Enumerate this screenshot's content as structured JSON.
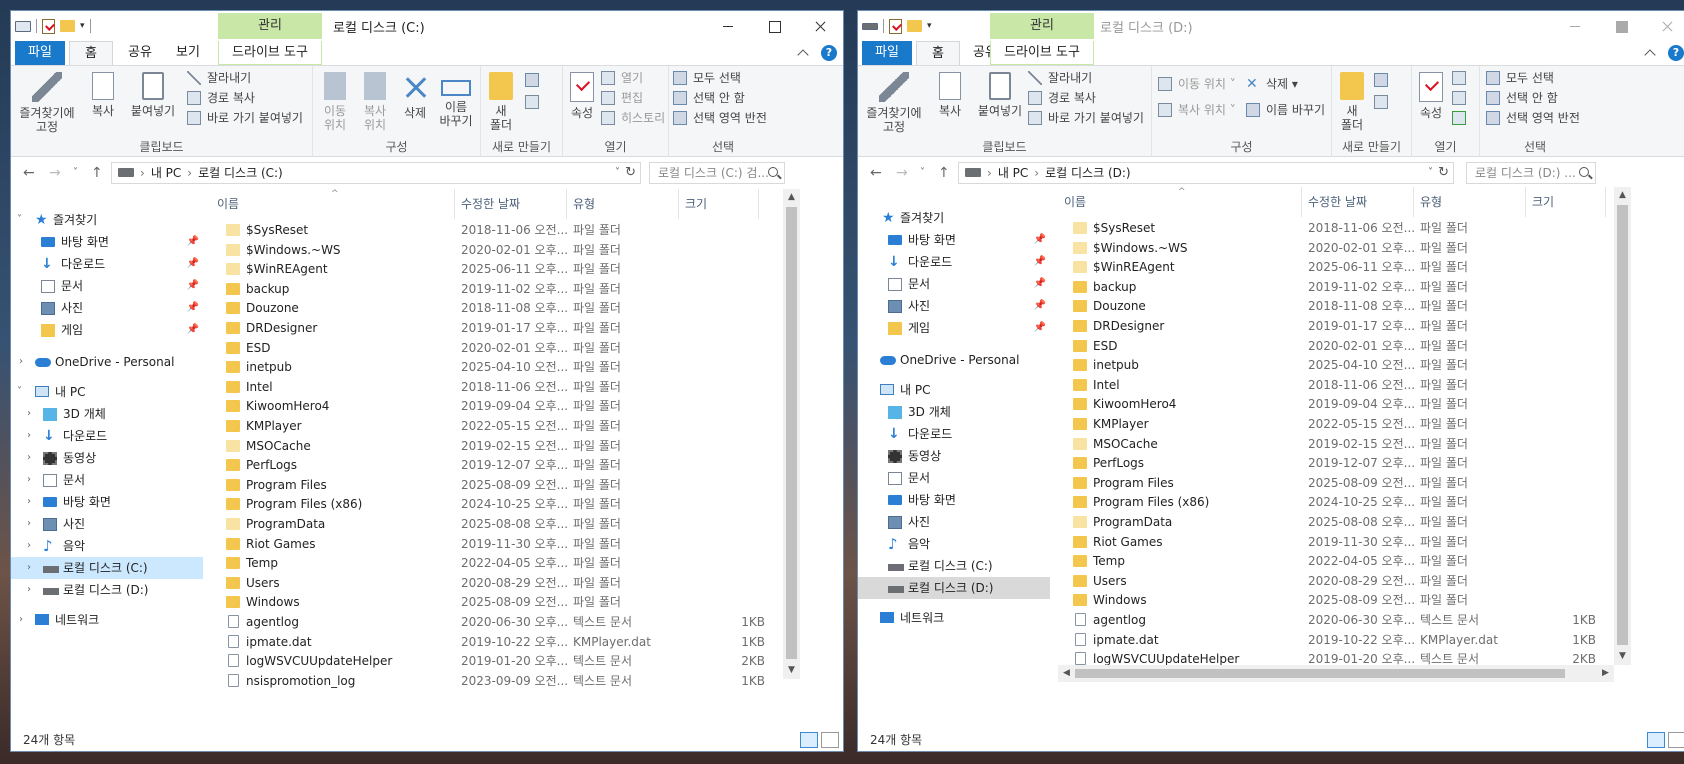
{
  "ribbon_labels": {
    "tabs": {
      "file": "파일",
      "home": "홈",
      "share": "공유",
      "view": "보기",
      "context_header": "관리",
      "drive_tools": "드라이브 도구"
    },
    "pin": "즐겨찾기에\n고정",
    "copy": "복사",
    "paste": "붙여넣기",
    "cut": "잘라내기",
    "copy_path": "경로 복사",
    "paste_shortcut": "바로 가기 붙여넣기",
    "clipboard_group": "클립보드",
    "move_to": "이동\n위치",
    "copy_to": "복사\n위치",
    "delete": "삭제",
    "rename": "이름\n바꾸기",
    "move_to_inline": "이동 위치",
    "copy_to_inline": "복사 위치",
    "delete_inline": "삭제",
    "rename_inline": "이름 바꾸기",
    "organize_group": "구성",
    "new_folder": "새\n폴더",
    "new_group": "새로 만들기",
    "properties": "속성",
    "open": "열기",
    "edit": "편집",
    "history": "히스토리",
    "open_group": "열기",
    "select_all": "모두 선택",
    "select_none": "선택 안 함",
    "invert": "선택 영역 반전",
    "select_group": "선택"
  },
  "nav_labels": {
    "favorites": "즐겨찾기",
    "desktop": "바탕 화면",
    "downloads": "다운로드",
    "documents": "문서",
    "pictures": "사진",
    "games": "게임",
    "onedrive": "OneDrive - Personal",
    "this_pc": "내 PC",
    "objects3d": "3D 개체",
    "videos": "동영상",
    "music": "음악",
    "drive_c": "로컬 디스크 (C:)",
    "drive_d": "로컬 디스크 (D:)",
    "network": "네트워크"
  },
  "columns": {
    "name": "이름",
    "modified": "수정한 날짜",
    "type": "유형",
    "size": "크기"
  },
  "files": [
    {
      "name": "$SysReset",
      "date": "2018-11-06 오전...",
      "type": "파일 폴더",
      "size": "",
      "icon": "sys"
    },
    {
      "name": "$Windows.~WS",
      "date": "2020-02-01 오후...",
      "type": "파일 폴더",
      "size": "",
      "icon": "sys"
    },
    {
      "name": "$WinREAgent",
      "date": "2025-06-11 오후...",
      "type": "파일 폴더",
      "size": "",
      "icon": "sys"
    },
    {
      "name": "backup",
      "date": "2019-11-02 오후...",
      "type": "파일 폴더",
      "size": "",
      "icon": "folder"
    },
    {
      "name": "Douzone",
      "date": "2018-11-08 오후...",
      "type": "파일 폴더",
      "size": "",
      "icon": "folder"
    },
    {
      "name": "DRDesigner",
      "date": "2019-01-17 오후...",
      "type": "파일 폴더",
      "size": "",
      "icon": "folder"
    },
    {
      "name": "ESD",
      "date": "2020-02-01 오후...",
      "type": "파일 폴더",
      "size": "",
      "icon": "folder"
    },
    {
      "name": "inetpub",
      "date": "2025-04-10 오전...",
      "type": "파일 폴더",
      "size": "",
      "icon": "folder"
    },
    {
      "name": "Intel",
      "date": "2018-11-06 오전...",
      "type": "파일 폴더",
      "size": "",
      "icon": "folder"
    },
    {
      "name": "KiwoomHero4",
      "date": "2019-09-04 오후...",
      "type": "파일 폴더",
      "size": "",
      "icon": "folder"
    },
    {
      "name": "KMPlayer",
      "date": "2022-05-15 오전...",
      "type": "파일 폴더",
      "size": "",
      "icon": "folder"
    },
    {
      "name": "MSOCache",
      "date": "2019-02-15 오전...",
      "type": "파일 폴더",
      "size": "",
      "icon": "sys"
    },
    {
      "name": "PerfLogs",
      "date": "2019-12-07 오후...",
      "type": "파일 폴더",
      "size": "",
      "icon": "folder"
    },
    {
      "name": "Program Files",
      "date": "2025-08-09 오전...",
      "type": "파일 폴더",
      "size": "",
      "icon": "folder"
    },
    {
      "name": "Program Files (x86)",
      "date": "2024-10-25 오후...",
      "type": "파일 폴더",
      "size": "",
      "icon": "folder"
    },
    {
      "name": "ProgramData",
      "date": "2025-08-08 오후...",
      "type": "파일 폴더",
      "size": "",
      "icon": "sys"
    },
    {
      "name": "Riot Games",
      "date": "2019-11-30 오후...",
      "type": "파일 폴더",
      "size": "",
      "icon": "folder"
    },
    {
      "name": "Temp",
      "date": "2022-04-05 오후...",
      "type": "파일 폴더",
      "size": "",
      "icon": "folder"
    },
    {
      "name": "Users",
      "date": "2020-08-29 오전...",
      "type": "파일 폴더",
      "size": "",
      "icon": "folder"
    },
    {
      "name": "Windows",
      "date": "2025-08-09 오전...",
      "type": "파일 폴더",
      "size": "",
      "icon": "folder"
    },
    {
      "name": "agentlog",
      "date": "2020-06-30 오후...",
      "type": "텍스트 문서",
      "size": "1KB",
      "icon": "txt"
    },
    {
      "name": "ipmate.dat",
      "date": "2019-10-22 오후...",
      "type": "KMPlayer.dat",
      "size": "1KB",
      "icon": "txt"
    },
    {
      "name": "logWSVCUUpdateHelper",
      "date": "2019-01-20 오후...",
      "type": "텍스트 문서",
      "size": "2KB",
      "icon": "txt"
    },
    {
      "name": "nsispromotion_log",
      "date": "2023-09-09 오전...",
      "type": "텍스트 문서",
      "size": "1KB",
      "icon": "txt"
    }
  ],
  "win1": {
    "title": "로컬 디스크 (C:)",
    "path": {
      "pc": "내 PC",
      "drive": "로컬 디스크 (C:)"
    },
    "search_placeholder": "로컬 디스크 (C:) 검...",
    "status": "24개 항목"
  },
  "win2": {
    "title": "로컬 디스크 (D:)",
    "path": {
      "pc": "내 PC",
      "drive": "로컬 디스크 (D:)"
    },
    "search_placeholder": "로컬 디스크 (D:) ...",
    "status": "24개 항목"
  },
  "colors": {
    "file_tab": "#1979ca",
    "context_tab": "#c9e8a8",
    "nav_selected_c": "#cce8ff",
    "nav_selected_d": "#d9d9d9",
    "folder": "#f3c64e"
  },
  "icons": [
    "pc-icon",
    "checkmark-doc-icon",
    "folder-icon",
    "pin-icon",
    "copy-icon",
    "paste-icon",
    "scissors-icon",
    "delete-x-icon",
    "rename-icon",
    "new-folder-icon",
    "properties-icon",
    "select-all-icon",
    "search-icon",
    "refresh-icon",
    "star-icon",
    "onedrive-cloud-icon",
    "drive-icon",
    "network-icon"
  ]
}
